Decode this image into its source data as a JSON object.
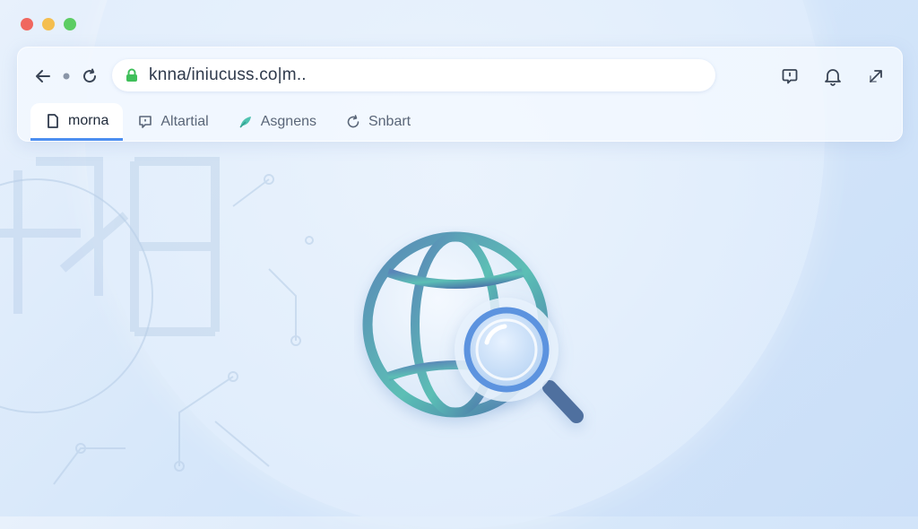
{
  "window": {
    "controls": [
      {
        "name": "close",
        "color": "#f0675f"
      },
      {
        "name": "minimize",
        "color": "#f4be4f"
      },
      {
        "name": "maximize",
        "color": "#5ccd63"
      }
    ]
  },
  "nav": {
    "back_icon": "arrow-left-icon",
    "dot_icon": "dot-icon",
    "reload_icon": "reload-icon"
  },
  "address_bar": {
    "url": "knna/iniucuss.co|m..",
    "lock_icon": "lock-icon",
    "lock_color": "#3fbf5a"
  },
  "toolbar_right": {
    "icons": [
      "chat-icon",
      "bell-icon",
      "expand-icon"
    ]
  },
  "tabs": [
    {
      "label": "morna",
      "icon": "document-icon",
      "active": true
    },
    {
      "label": "Altartial",
      "icon": "comment-icon",
      "active": false
    },
    {
      "label": "Asgnens",
      "icon": "leaf-icon",
      "active": false
    },
    {
      "label": "Snbart",
      "icon": "refresh-icon",
      "active": false
    }
  ],
  "colors": {
    "accent": "#4c8ef0",
    "globe_teal": "#5bbfb5",
    "globe_blue": "#4a6fa8"
  },
  "hero_icon": "globe-search-icon"
}
